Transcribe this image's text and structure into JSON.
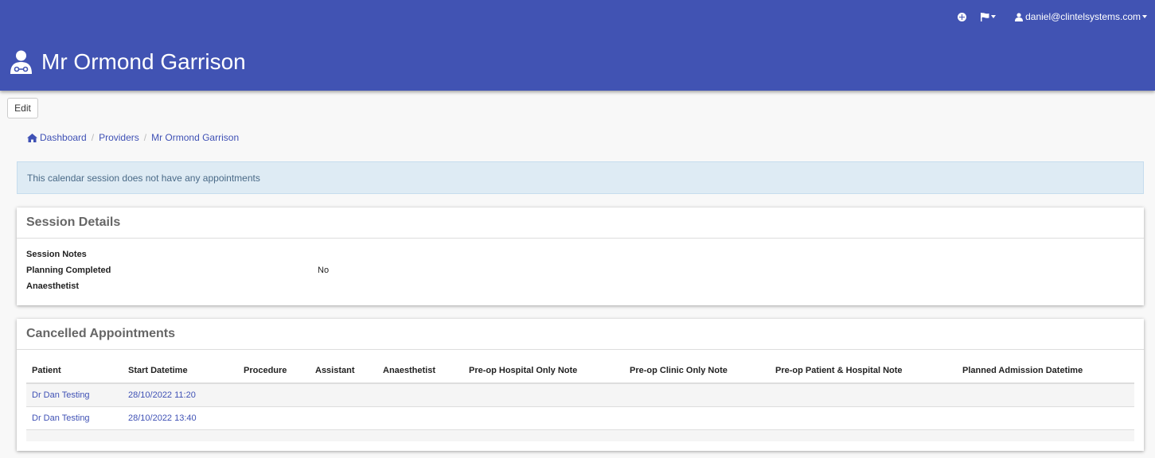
{
  "header": {
    "title": "Mr Ormond Garrison",
    "user_email": "daniel@clintelsystems.com",
    "icons": [
      "add-icon",
      "flag-icon",
      "user-icon",
      "doctor-icon"
    ],
    "bg_color": "#4153b3"
  },
  "toolbar": {
    "edit_label": "Edit"
  },
  "breadcrumb": {
    "items": [
      "Dashboard",
      "Providers",
      "Mr Ormond Garrison"
    ]
  },
  "alert": {
    "text": "This calendar session does not have any appointments"
  },
  "session_details": {
    "title": "Session Details",
    "rows": [
      {
        "label": "Session Notes",
        "value": ""
      },
      {
        "label": "Planning Completed",
        "value": "No"
      },
      {
        "label": "Anaesthetist",
        "value": ""
      }
    ]
  },
  "cancelled": {
    "title": "Cancelled Appointments",
    "columns": [
      "Patient",
      "Start Datetime",
      "Procedure",
      "Assistant",
      "Anaesthetist",
      "Pre-op Hospital Only Note",
      "Pre-op Clinic Only Note",
      "Pre-op Patient & Hospital Note",
      "Planned Admission Datetime"
    ],
    "rows": [
      {
        "patient": "Dr Dan Testing",
        "start": "28/10/2022 11:20"
      },
      {
        "patient": "Dr Dan Testing",
        "start": "28/10/2022 13:40"
      }
    ]
  },
  "link_color": "#3f51b5"
}
